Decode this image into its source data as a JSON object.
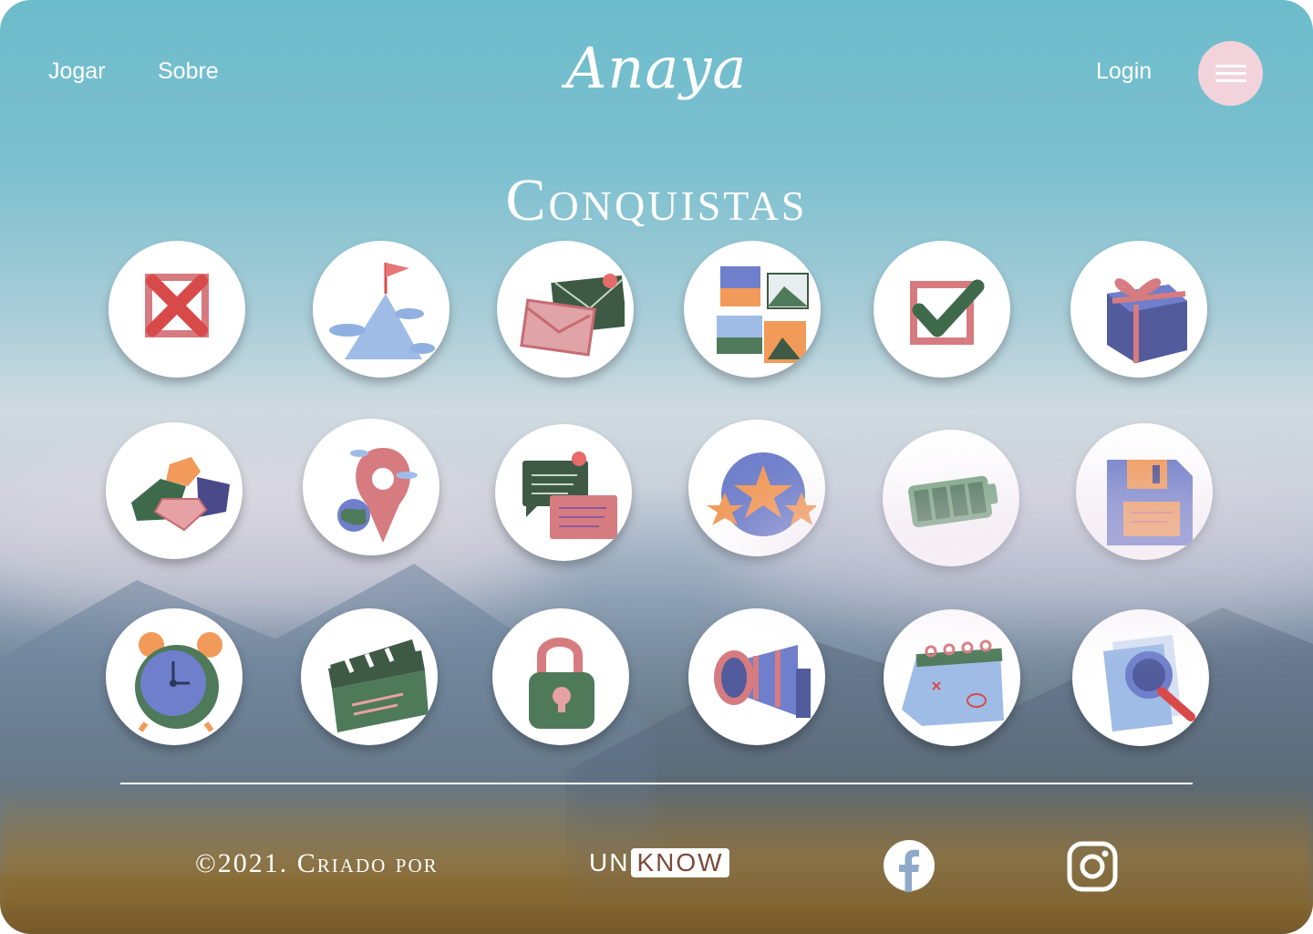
{
  "nav": {
    "jogar": "Jogar",
    "sobre": "Sobre",
    "logo": "Anaya",
    "login": "Login",
    "menu_icon": "hamburger-menu-icon"
  },
  "page": {
    "title": "Conquistas"
  },
  "achievements": [
    {
      "icon": "x-mark-icon"
    },
    {
      "icon": "mountain-flag-icon"
    },
    {
      "icon": "envelopes-icon"
    },
    {
      "icon": "photos-icon"
    },
    {
      "icon": "checkmark-icon"
    },
    {
      "icon": "gift-icon"
    },
    {
      "icon": "gems-icon"
    },
    {
      "icon": "location-pin-icon"
    },
    {
      "icon": "chat-bubbles-icon"
    },
    {
      "icon": "stars-icon"
    },
    {
      "icon": "battery-icon"
    },
    {
      "icon": "floppy-disk-icon"
    },
    {
      "icon": "alarm-clock-icon"
    },
    {
      "icon": "clapperboard-icon"
    },
    {
      "icon": "padlock-icon"
    },
    {
      "icon": "megaphone-icon"
    },
    {
      "icon": "calendar-icon"
    },
    {
      "icon": "document-search-icon"
    }
  ],
  "footer": {
    "copyright": "©2021. Criado por",
    "brand_prefix": "UN",
    "brand_box": "KNOW",
    "facebook_icon": "facebook-icon",
    "instagram_icon": "instagram-icon"
  },
  "colors": {
    "white": "#ffffff",
    "menu_button": "#f2d3dc",
    "pink": "#d67b80",
    "green": "#4e7a5a",
    "blue": "#6f7fcb",
    "orange": "#f29a59",
    "purple": "#4a4a8a",
    "light_blue": "#9fbce6"
  }
}
